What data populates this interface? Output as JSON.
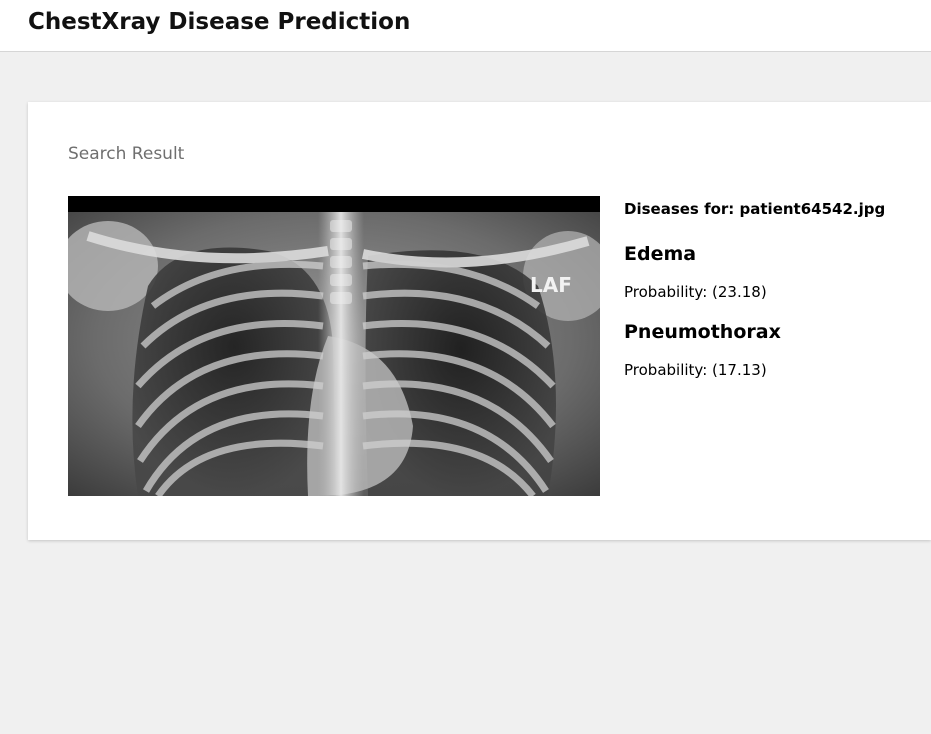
{
  "header": {
    "title": "ChestXray Disease Prediction"
  },
  "result": {
    "section_title": "Search Result",
    "image_alt": "chest x-ray",
    "diseases_for_label": "Diseases for: patient64542.jpg",
    "xray_marker": "LAF",
    "predictions": [
      {
        "name": "Edema",
        "probability_text": "Probability: (23.18)"
      },
      {
        "name": "Pneumothorax",
        "probability_text": "Probability: (17.13)"
      }
    ]
  },
  "colors": {
    "page_background": "#f0f0f0",
    "card_background": "#ffffff",
    "muted_title": "#6f6f6f"
  }
}
